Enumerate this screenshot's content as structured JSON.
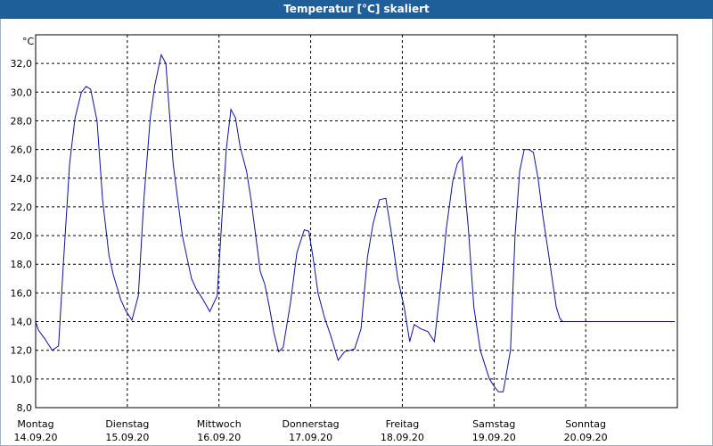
{
  "window": {
    "title": "Temperatur [°C] skaliert"
  },
  "colors": {
    "line": "#1010a0",
    "titlebar": "#1f5f99",
    "grid": "#000000"
  },
  "chart_data": {
    "type": "line",
    "title": "Temperatur [°C] skaliert",
    "ylabel": "°C",
    "xlabel": "",
    "ylim": [
      8,
      34
    ],
    "yticks": [
      "8,0",
      "10,0",
      "12,0",
      "14,0",
      "16,0",
      "18,0",
      "20,0",
      "22,0",
      "24,0",
      "26,0",
      "28,0",
      "30,0",
      "32,0"
    ],
    "xlim": [
      0,
      7
    ],
    "days": [
      {
        "weekday": "Montag",
        "date": "14.09.20"
      },
      {
        "weekday": "Dienstag",
        "date": "15.09.20"
      },
      {
        "weekday": "Mittwoch",
        "date": "16.09.20"
      },
      {
        "weekday": "Donnerstag",
        "date": "17.09.20"
      },
      {
        "weekday": "Freitag",
        "date": "18.09.20"
      },
      {
        "weekday": "Samstag",
        "date": "19.09.20"
      },
      {
        "weekday": "Sonntag",
        "date": "20.09.20"
      }
    ],
    "grid": true,
    "series": [
      {
        "x": [
          0.0,
          0.03,
          0.1,
          0.18,
          0.25,
          0.3,
          0.37,
          0.43,
          0.5,
          0.55,
          0.6,
          0.67,
          0.73,
          0.8,
          0.85,
          0.93,
          0.98,
          1.05,
          1.12,
          1.18,
          1.25,
          1.3,
          1.37,
          1.42,
          1.5,
          1.6,
          1.65,
          1.7,
          1.75,
          1.82,
          1.9,
          1.98,
          2.03,
          2.08,
          2.13,
          2.18,
          2.23,
          2.3,
          2.35,
          2.4,
          2.45,
          2.5,
          2.55,
          2.6,
          2.65,
          2.7,
          2.78,
          2.85,
          2.93,
          2.98,
          3.03,
          3.08,
          3.15,
          3.22,
          3.3,
          3.37,
          3.43,
          3.48,
          3.55,
          3.62,
          3.68,
          3.75,
          3.82,
          3.88,
          3.95,
          4.02,
          4.08,
          4.13,
          4.2,
          4.28,
          4.35,
          4.43,
          4.48,
          4.55,
          4.6,
          4.65,
          4.72,
          4.78,
          4.85,
          4.9,
          4.95,
          5.0,
          5.05,
          5.1,
          5.18,
          5.23,
          5.28,
          5.33,
          5.38,
          5.43,
          5.48,
          5.53,
          5.6,
          5.68,
          5.72,
          5.75,
          5.82,
          5.88,
          5.95,
          6.0,
          6.05,
          6.1,
          6.15,
          6.2,
          6.25,
          6.32,
          6.38,
          6.43,
          6.48,
          6.52,
          6.55,
          6.6,
          6.68,
          6.78,
          6.88,
          6.96
        ],
        "y": [
          14.0,
          13.4,
          12.8,
          12.0,
          12.3,
          17.8,
          25.0,
          28.2,
          30.0,
          30.4,
          30.2,
          28.0,
          22.5,
          18.6,
          17.2,
          15.5,
          14.8,
          14.1,
          15.8,
          22.5,
          28.2,
          30.5,
          32.6,
          32.0,
          25.0,
          20.0,
          18.5,
          17.0,
          16.3,
          15.6,
          14.7,
          15.8,
          21.0,
          26.0,
          28.8,
          28.2,
          26.2,
          24.5,
          22.5,
          20.0,
          17.5,
          16.6,
          15.0,
          13.2,
          11.9,
          12.2,
          15.3,
          18.8,
          20.4,
          20.3,
          18.3,
          16.0,
          14.3,
          13.0,
          11.3,
          11.9,
          12.0,
          12.1,
          13.5,
          18.5,
          20.8,
          22.5,
          22.6,
          20.2,
          17.0,
          15.0,
          12.6,
          13.8,
          13.5,
          13.3,
          12.6,
          17.2,
          20.5,
          23.8,
          25.0,
          25.5,
          20.5,
          15.0,
          12.0,
          11.0,
          10.0,
          9.5,
          9.1,
          9.1,
          12.0,
          20.0,
          24.5,
          26.0,
          26.0,
          25.8,
          24.0,
          21.5,
          18.5,
          15.0,
          14.2,
          14.0,
          14.0,
          14.0,
          14.0,
          14.0,
          14.0,
          14.0,
          14.0,
          14.0,
          14.0,
          14.0,
          14.0,
          14.0,
          14.0,
          14.0,
          14.0,
          14.0,
          14.0,
          14.0,
          14.0,
          14.0
        ]
      }
    ]
  }
}
